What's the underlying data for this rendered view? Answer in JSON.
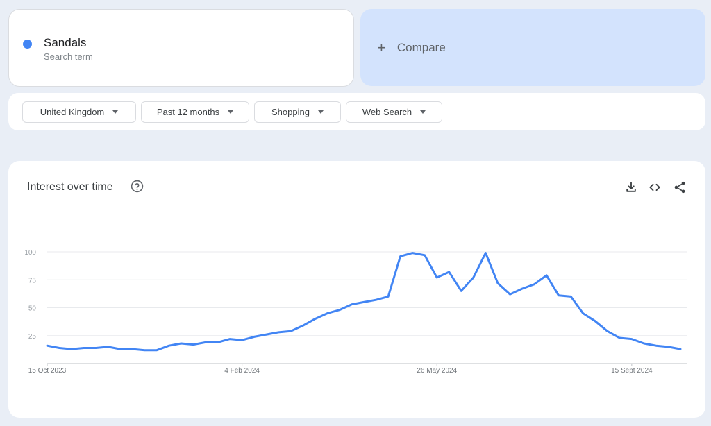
{
  "term": {
    "name": "Sandals",
    "subtitle": "Search term",
    "dot_color": "#4285f4"
  },
  "compare": {
    "plus": "+",
    "label": "Compare"
  },
  "filters": [
    {
      "label": "United Kingdom"
    },
    {
      "label": "Past 12 months"
    },
    {
      "label": "Shopping"
    },
    {
      "label": "Web Search"
    }
  ],
  "panel": {
    "title": "Interest over time",
    "icons": [
      "help-icon",
      "download-icon",
      "embed-icon",
      "share-icon"
    ]
  },
  "chart_data": {
    "type": "line",
    "ylim": [
      0,
      100
    ],
    "yticks": [
      25,
      50,
      75,
      100
    ],
    "grid": true,
    "x_tick_labels": [
      {
        "label": "15 Oct 2023",
        "index": 0
      },
      {
        "label": "4 Feb 2024",
        "index": 16
      },
      {
        "label": "26 May 2024",
        "index": 32
      },
      {
        "label": "15 Sept 2024",
        "index": 48
      }
    ],
    "series": [
      {
        "color": "#4285f4",
        "values": [
          16,
          14,
          13,
          14,
          14,
          15,
          13,
          13,
          12,
          12,
          16,
          18,
          17,
          19,
          19,
          22,
          21,
          24,
          26,
          28,
          29,
          34,
          40,
          45,
          48,
          53,
          55,
          57,
          60,
          96,
          99,
          97,
          77,
          82,
          65,
          77,
          99,
          72,
          62,
          67,
          71,
          79,
          61,
          60,
          45,
          38,
          29,
          23,
          22,
          18,
          16,
          15,
          13
        ]
      }
    ]
  }
}
